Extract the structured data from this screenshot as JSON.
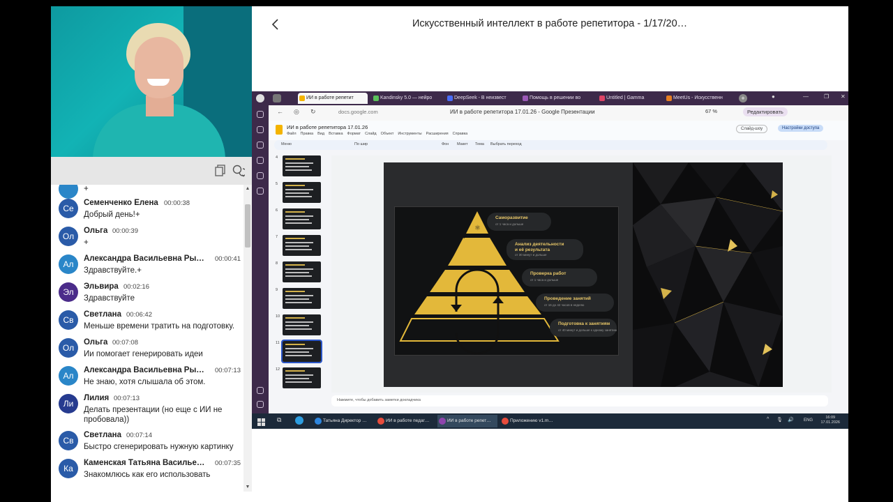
{
  "header": {
    "back_icon": "chevron-left-icon",
    "title": "Искусственный интеллект в работе репетитора - 1/17/20…"
  },
  "chat": {
    "toolbar_icons": [
      "copy-icon",
      "chat-bubbles-icon"
    ],
    "partial_message_text": "+",
    "messages": [
      {
        "initials": "Се",
        "name": "Семенченко Елена",
        "time": "00:00:38",
        "text": "Добрый день!+",
        "color": "#2a5ba8"
      },
      {
        "initials": "Ол",
        "name": "Ольга",
        "time": "00:00:39",
        "text": "+",
        "color": "#2a5ba8"
      },
      {
        "initials": "Ал",
        "name": "Александра Васильевна Ры…",
        "time": "00:00:41",
        "text": "Здравствуйте.+",
        "color": "#2a86c8"
      },
      {
        "initials": "Эл",
        "name": "Эльвира",
        "time": "00:02:16",
        "text": "Здравствуйте",
        "color": "#4b2c8a"
      },
      {
        "initials": "Св",
        "name": "Светлана",
        "time": "00:06:42",
        "text": "Меньше времени тратить на подготовку.",
        "color": "#2a5ba8"
      },
      {
        "initials": "Ол",
        "name": "Ольга",
        "time": "00:07:08",
        "text": "Ии помогает генерировать идеи",
        "color": "#2a5ba8"
      },
      {
        "initials": "Ал",
        "name": "Александра Васильевна Ры…",
        "time": "00:07:13",
        "text": "Не знаю, хотя слышала об этом.",
        "color": "#2a86c8"
      },
      {
        "initials": "Ли",
        "name": "Лилия",
        "time": "00:07:13",
        "text": "Делать презентации (но еще с ИИ не пробовала))",
        "color": "#263b8f"
      },
      {
        "initials": "Св",
        "name": "Светлана",
        "time": "00:07:14",
        "text": "Быстро сгенерировать нужную картинку",
        "color": "#2a5ba8"
      },
      {
        "initials": "Ка",
        "name": "Каменская Татьяна Василье…",
        "time": "00:07:35",
        "text": "Знакомлюсь как его использовать",
        "color": "#2a5ba8"
      }
    ]
  },
  "browser": {
    "tabs": [
      {
        "label": "ИИ в работе репетит",
        "color": "#f4b400",
        "active": true
      },
      {
        "label": "Kandinsky 5.0 — нейро",
        "color": "#5ac05a",
        "active": false
      },
      {
        "label": "DeepSeek - В неизвест",
        "color": "#4a6cf7",
        "active": false
      },
      {
        "label": "Помощь в решении во",
        "color": "#9b59b6",
        "active": false
      },
      {
        "label": "Untitled | Gamma",
        "color": "#d46",
        "active": false
      },
      {
        "label": "MeetUs - Искусственн",
        "color": "#e67e22",
        "active": false
      }
    ],
    "url": "docs.google.com",
    "page_title": "ИИ в работе репетитора 17.01.26 - Google Презентации",
    "zoom": "67 %",
    "edit_label": "Редактировать"
  },
  "slides_app": {
    "doc_title": "ИИ в работе репетитора 17.01.26",
    "menus": [
      "Файл",
      "Правка",
      "Вид",
      "Вставка",
      "Формат",
      "Слайд",
      "Объект",
      "Инструменты",
      "Расширения",
      "Справка"
    ],
    "show_button": "Слайд-шоу",
    "share_button": "Настройки доступа",
    "toolbar": [
      "Меню",
      "По шир",
      "Фон",
      "Макет",
      "Тема",
      "Выбрать переход"
    ],
    "slide_numbers": [
      "4",
      "5",
      "6",
      "7",
      "8",
      "9",
      "10",
      "11",
      "12"
    ],
    "selected_slide": "11",
    "notes_placeholder": "Нажмите, чтобы добавить заметки докладчика"
  },
  "pyramid": {
    "levels": [
      {
        "title": "Саморазвитие",
        "subtitle": "от 1 часа и дольше"
      },
      {
        "title": "Анализ деятельности\nи её результата",
        "subtitle": "от 30 минут и дольше"
      },
      {
        "title": "Проверка работ",
        "subtitle": "от 1 часа и дольше"
      },
      {
        "title": "Проведение занятий",
        "subtitle": "от 16 до 42 часов в неделю"
      },
      {
        "title": "Подготовка к занятиям",
        "subtitle": "от 40 минут и дольше к одному занятию"
      }
    ]
  },
  "taskbar": {
    "items": [
      {
        "label": "Татьяна Директор …",
        "color": "#2e86de",
        "active": false
      },
      {
        "label": "ИИ в работе педаг…",
        "color": "#e74c3c",
        "active": false
      },
      {
        "label": "ИИ в работе репет…",
        "color": "#8e44ad",
        "active": true
      },
      {
        "label": "Приложению v1.m…",
        "color": "#e74c3c",
        "active": false
      }
    ],
    "language": "ENG",
    "time": "16:09",
    "date": "17.01.2026"
  }
}
